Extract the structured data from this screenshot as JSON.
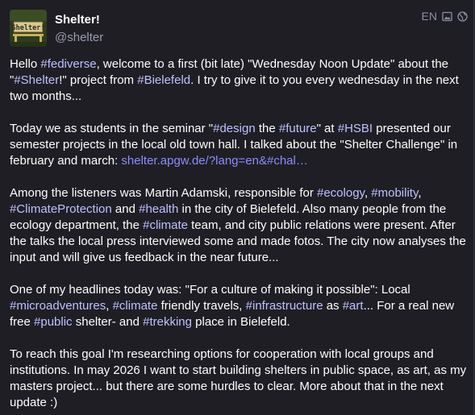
{
  "account": {
    "display_name": "Shelter!",
    "handle": "@shelter",
    "avatar_text": "Shelter!"
  },
  "meta": {
    "language": "EN",
    "icons": [
      "image-icon",
      "globe-icon"
    ]
  },
  "colors": {
    "background": "#1e1e24",
    "text": "#ffffff",
    "hashtag": "#bfc2ff",
    "link": "#8c8dff",
    "muted": "#8d8ea8"
  },
  "post": {
    "p1": {
      "s1": "Hello ",
      "h1": "#fediverse",
      "s2": ", welcome to a first (bit late) \"Wednesday Noon Update\" about the \"",
      "h2": "#Shelter",
      "s3": "!\" project from ",
      "h3": "#Bielefeld",
      "s4": ". I try to give it to you every wednesday in the next two months..."
    },
    "p2": {
      "s1": "Today we as students in the seminar \"",
      "h1": "#design",
      "s2": " the ",
      "h2": "#future",
      "s3": "\" at ",
      "h3": "#HSBI",
      "s4": " presented our semester projects in the local old town hall. I talked about the \"Shelter Challenge\" in february and march: ",
      "link": "shelter.apgw.de/?lang=en&#chal…"
    },
    "p3": {
      "s1": "Among the listeners was Martin Adamski, responsible for ",
      "h1": "#ecology",
      "s2": ", ",
      "h2": "#mobility",
      "s3": ", ",
      "h3": "#ClimateProtection",
      "s4": " and ",
      "h4": "#health",
      "s5": " in the city of Bielefeld. Also many people from the ecology department, the ",
      "h5": "#climate",
      "s6": " team, and city public relations were present. After the talks the local press interviewed some and made fotos. The city now analyses the input and will give us feedback in the near future..."
    },
    "p4": {
      "s1": "One of my headlines today was: \"For a culture of making it possible\": Local ",
      "h1": "#microadventures",
      "s2": ", ",
      "h2": "#climate",
      "s3": " friendly travels, ",
      "h3": "#infrastructure",
      "s4": " as ",
      "h4": "#art",
      "s5": "... For a real new free ",
      "h5": "#public",
      "s6": " shelter- and ",
      "h6": "#trekking",
      "s7": " place in Bielefeld."
    },
    "p5": {
      "s1": "To reach this goal I'm researching options for cooperation with local groups and institutions. In may 2026 I want to start building shelters in public space, as art, as my masters project... but there are some hurdles to clear. More about that in the next update :)"
    }
  }
}
